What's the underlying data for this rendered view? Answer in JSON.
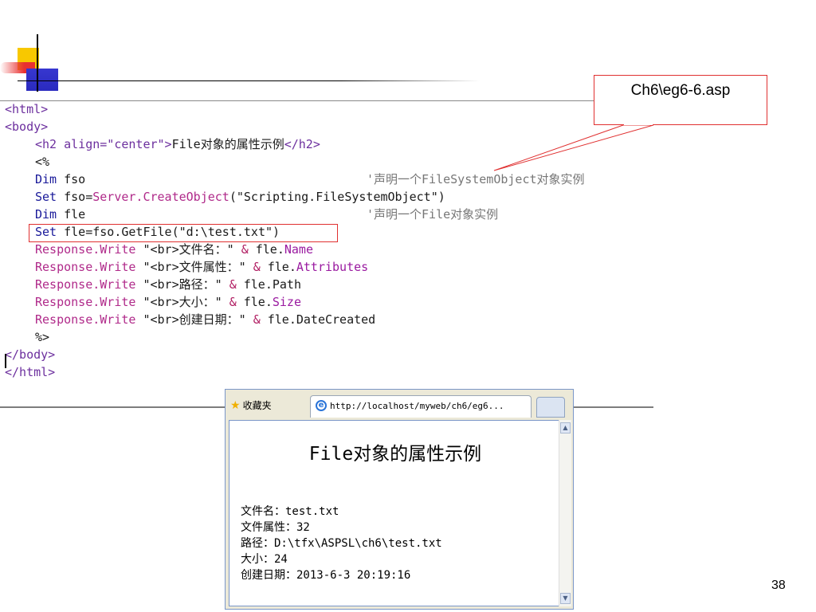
{
  "callout": {
    "label": "Ch6\\eg6-6.asp"
  },
  "code": {
    "l1": "<html>",
    "l2": "<body>",
    "l3_tag_open": "<h2 align=\"center\">",
    "l3_text": "File对象的属性示例",
    "l3_tag_close": "</h2>",
    "l4": "<%",
    "l5_kw": "Dim",
    "l5_var": " fso",
    "l5_comment": "'声明一个FileSystemObject对象实例",
    "l6_kw": "Set",
    "l6_assign": " fso=",
    "l6_fn": "Server.CreateObject",
    "l6_arg": "(\"Scripting.FileSystemObject\")",
    "l7_kw": "Dim",
    "l7_var": " fle",
    "l7_comment": "'声明一个File对象实例",
    "l8_kw": "Set",
    "l8_rest": " fle=fso.GetFile(\"d:\\test.txt\")",
    "rw": "Response.Write",
    "w1_str": " \"<br>文件名：\" ",
    "w1_prop": "Name",
    "w2_str": " \"<br>文件属性：\" ",
    "w2_prop": "Attributes",
    "w3_str": " \"<br>路径：\" ",
    "w3_prop": "Path",
    "w4_str": " \"<br>大小：\" ",
    "w4_prop": "Size",
    "w5_str": " \"<br>创建日期：\" ",
    "w5_prop": "DateCreated",
    "amp": "&",
    "obj": " fle.",
    "l14": "%>",
    "l15": "</body>",
    "l16": "</html>"
  },
  "browser": {
    "favorites_label": "收藏夹",
    "tab_title": "http://localhost/myweb/ch6/eg6...",
    "heading": "File对象的属性示例",
    "results": [
      "文件名：test.txt",
      "文件属性：32",
      "路径：D:\\tfx\\ASPSL\\ch6\\test.txt",
      "大小：24",
      "创建日期：2013-6-3 20:19:16"
    ]
  },
  "slide": {
    "page_number": "38"
  },
  "colors": {
    "highlight": "#e03030",
    "logo_yellow": "#f8c800",
    "logo_blue": "#3737d0",
    "logo_red": "#e83030"
  }
}
